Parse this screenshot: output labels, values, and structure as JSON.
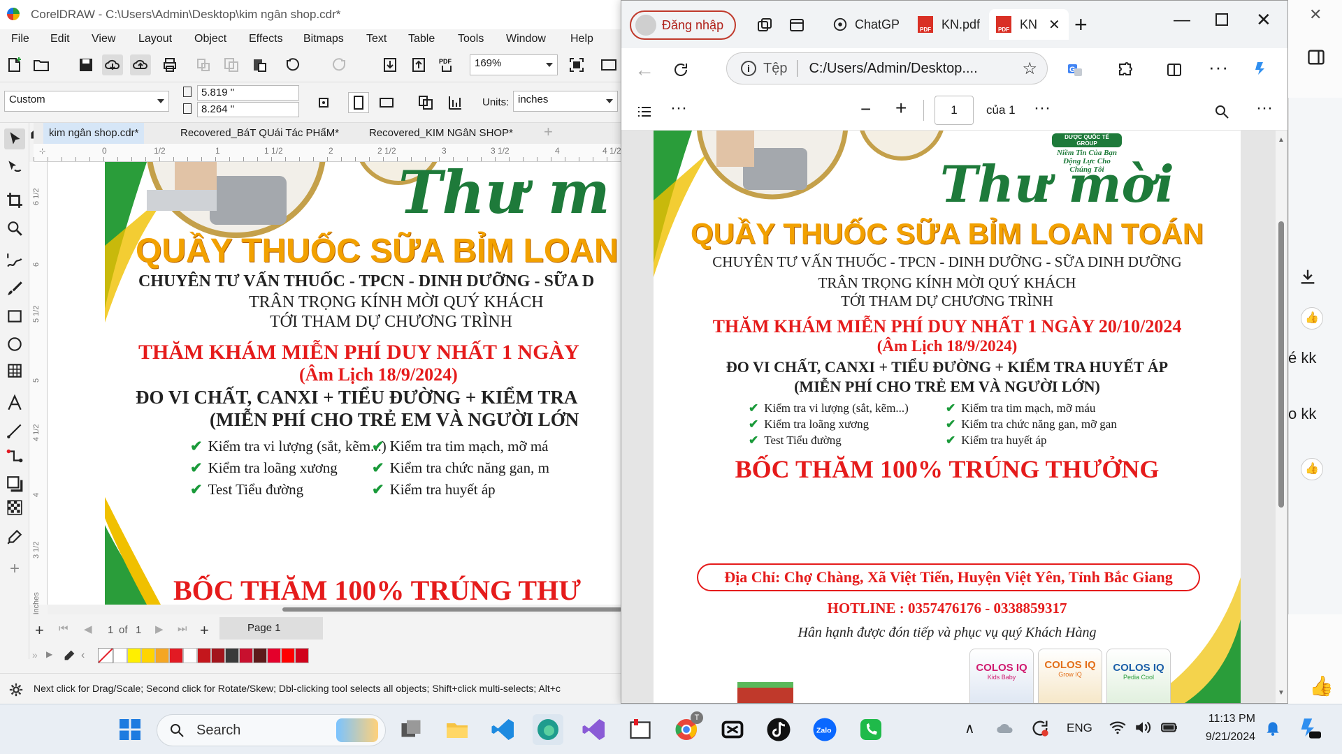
{
  "corel": {
    "title": "CorelDRAW - C:\\Users\\Admin\\Desktop\\kim ngân shop.cdr*",
    "menu": [
      "File",
      "Edit",
      "View",
      "Layout",
      "Object",
      "Effects",
      "Bitmaps",
      "Text",
      "Table",
      "Tools",
      "Window",
      "Help"
    ],
    "zoom": "169%",
    "page_preset": "Custom",
    "width": "5.819 \"",
    "height": "8.264 \"",
    "units_label": "Units:",
    "units_value": "inches",
    "doc_tabs": [
      "kim ngân shop.cdr*",
      "Recovered_BáT QUái Tác PHẩM*",
      "Recovered_KIM NGâN SHOP*"
    ],
    "ruler_h": [
      "0",
      "1/2",
      "1",
      "1 1/2",
      "2",
      "2 1/2",
      "3",
      "3 1/2",
      "4",
      "4 1/2"
    ],
    "ruler_v": [
      "6 1/2",
      "6",
      "5 1/2",
      "5",
      "4 1/2",
      "4",
      "3 1/2",
      "inches"
    ],
    "page_counter": "1",
    "page_of": "of",
    "page_total": "1",
    "page_tab": "Page 1",
    "status": "Next click for Drag/Scale; Second click for Rotate/Skew; Dbl-clicking tool selects all objects; Shift+click multi-selects; Alt+c",
    "palette": [
      "#ffffff",
      "#ffef00",
      "#ffd400",
      "#f5a623",
      "#e21a23",
      "#ffffff",
      "#c4161c",
      "#a3141c",
      "#3a3a3a",
      "#c8102e",
      "#5c1a1a",
      "#e4002b",
      "#ff0000",
      "#d0021b"
    ]
  },
  "flyer": {
    "logo_group": "DƯỢC QUỐC TẾ GROUP",
    "logo_slogan_1": "Niềm Tin Của Bạn",
    "logo_slogan_2": "Động Lực Cho Chúng Tôi",
    "heading": "Thư mời",
    "shop": "QUẦY THUỐC SỮA BỈM LOAN TOÁN",
    "specialty": "CHUYÊN TƯ VẤN THUỐC - TPCN - DINH DƯỠNG - SỮA DINH DƯỠNG",
    "invite_1": "TRÂN TRỌNG KÍNH MỜI QUÝ KHÁCH",
    "invite_2": "TỚI THAM DỰ CHƯƠNG TRÌNH",
    "event": "THĂM KHÁM MIỄN PHÍ DUY NHẤT 1 NGÀY 20/10/2024",
    "event_corel": "THĂM KHÁM MIỄN PHÍ DUY NHẤT 1 NGÀY",
    "lunar": "(Âm Lịch 18/9/2024)",
    "measure": "ĐO VI CHẤT, CANXI + TIỂU ĐƯỜNG + KIỂM TRA HUYẾT ÁP",
    "measure_corel": "ĐO VI CHẤT, CANXI + TIỂU ĐƯỜNG + KIỂM TRA",
    "free_for": "(MIỄN PHÍ CHO TRẺ EM VÀ NGƯỜI LỚN)",
    "free_for_corel": "(MIỄN PHÍ CHO TRẺ EM VÀ NGƯỜI LỚN",
    "checks_left": [
      "Kiểm tra vi lượng (sắt, kẽm...)",
      "Kiểm tra loãng xương",
      "Test Tiểu đường"
    ],
    "checks_right": [
      "Kiểm tra tim mạch, mỡ máu",
      "Kiểm tra chức năng gan, mỡ gan",
      "Kiểm tra huyết áp"
    ],
    "checks_right_corel": [
      "Kiểm tra tim mạch, mỡ má",
      "Kiểm tra chức năng gan, m",
      "Kiểm tra huyết áp"
    ],
    "specialty_corel": "CHUYÊN TƯ VẤN THUỐC - TPCN - DINH DƯỠNG - SỮA D",
    "shop_corel": "QUẦY THUỐC SỮA BỈM LOAN",
    "heading_corel": "Thư m",
    "prize": "BỐC THĂM 100% TRÚNG THƯỞNG",
    "prize_corel": "BỐC THĂM 100% TRÚNG THƯ",
    "address": "Địa Chỉ: Chợ Chàng, Xã Việt Tiến, Huyện Việt Yên, Tỉnh Bắc Giang",
    "hotline": "HOTLINE : 0357476176 - 0338859317",
    "welcome": "Hân hạnh được đón tiếp và phục vụ quý Khách Hàng",
    "product_1": "COLOS IQ",
    "product_1_sub": "Kids Baby",
    "product_2": "COLOS IQ",
    "product_2_sub": "Grow IQ",
    "product_3": "COLOS IQ",
    "product_3_sub": "Pedia Cool"
  },
  "edge": {
    "login": "Đăng nhập",
    "tab_chatgpt": "ChatGP",
    "tab_kn": "KN.pdf",
    "tab_active": "KN",
    "url_label": "Tệp",
    "url": "C:/Users/Admin/Desktop....",
    "page_input": "1",
    "page_of": "của 1"
  },
  "right_strip": {
    "text_1": "é kk",
    "text_2": "o kk"
  },
  "taskbar": {
    "search": "Search",
    "lang": "ENG",
    "time": "11:13 PM",
    "date": "9/21/2024",
    "chrome_badge": "T"
  }
}
